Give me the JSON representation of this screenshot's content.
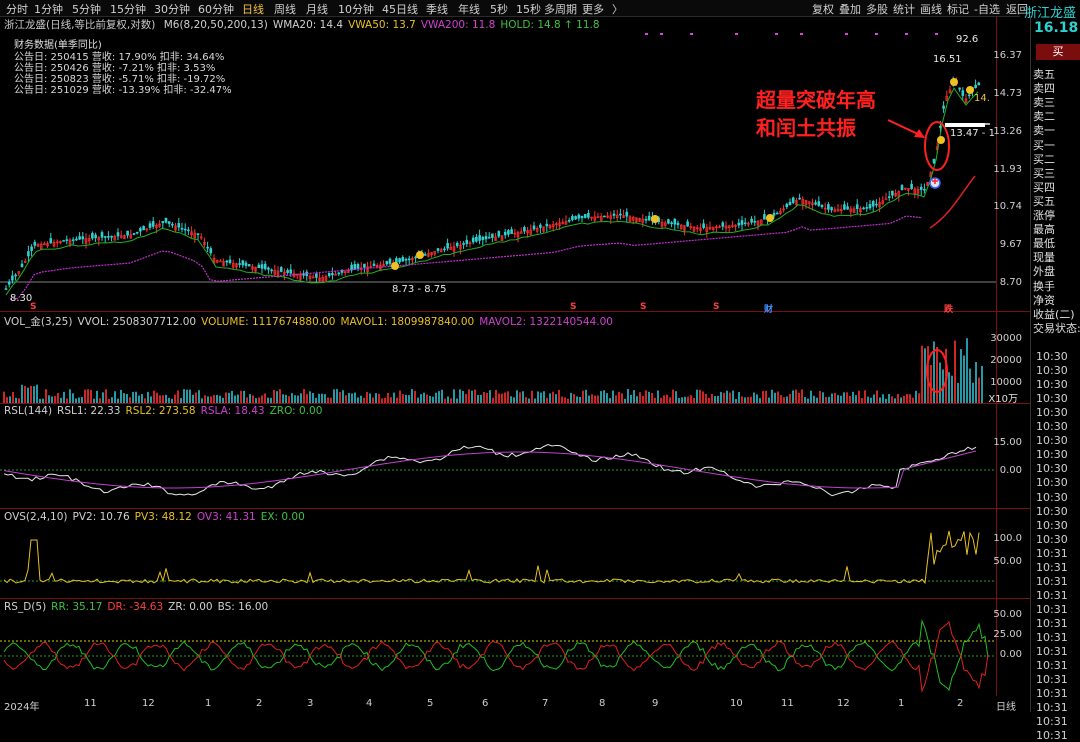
{
  "toolbar": {
    "periods": [
      "分时",
      "1分钟",
      "5分钟",
      "15分钟",
      "30分钟",
      "60分钟",
      "日线",
      "周线",
      "月线",
      "10分钟",
      "45日线",
      "季线",
      "年线",
      "5秒",
      "15秒",
      "多周期",
      "更多"
    ],
    "active_period": "日线",
    "right_tools": [
      "复权",
      "叠加",
      "多股",
      "统计",
      "画线",
      "标记",
      "-自选",
      "返回"
    ]
  },
  "stock": {
    "name": "浙江龙盛",
    "price": "16.18",
    "buy_label": "买"
  },
  "main_chart": {
    "legend_title": "浙江龙盛(日线,等比前复权,对数)",
    "legend_items": [
      {
        "text": "M6(8,20,50,200,13)",
        "color": "#d0d0d0"
      },
      {
        "text": "WMA20: 14.4",
        "color": "#d0d0d0"
      },
      {
        "text": "VWA50: 13.7",
        "color": "#e8c020"
      },
      {
        "text": "VWA200: 11.8",
        "color": "#d040d0"
      },
      {
        "text": "HOLD: 14.8 ↑ 11.8",
        "color": "#40c040"
      }
    ],
    "financials_title": "财务数据(单季同比)",
    "financials": [
      "公告日: 250415  营收: 17.90%  扣非: 34.64%",
      "公告日: 250426  营收: -7.21%  扣非: 3.53%",
      "公告日: 250823  营收: -5.71%  扣非: -19.72%",
      "公告日: 251029  营收: -13.39%  扣非: -32.47%"
    ],
    "y_axis": [
      "16.37",
      "14.73",
      "13.26",
      "11.93",
      "10.74",
      "9.67",
      "8.70"
    ],
    "annotations": {
      "low_start": "8.30",
      "low_range": "8.73 - 8.75",
      "high": "16.51",
      "high_range": "13.47 - 1",
      "top_edge": "92.6",
      "right_val": "14."
    },
    "note_line1": "超量突破年高",
    "note_line2": "和闰土共振",
    "markers": [
      {
        "text": "S",
        "color": "#ff4040"
      },
      {
        "text": "S",
        "color": "#ff4040"
      },
      {
        "text": "S",
        "color": "#ff4040"
      },
      {
        "text": "S",
        "color": "#ff4040"
      },
      {
        "text": "财",
        "color": "#4090ff"
      },
      {
        "text": "跌",
        "color": "#ff4040"
      }
    ]
  },
  "volume_panel": {
    "legend": [
      {
        "text": "VOL_金(3,25)",
        "color": "#d0d0d0"
      },
      {
        "text": "VVOL: 2508307712.00",
        "color": "#d0d0d0"
      },
      {
        "text": "VOLUME: 1117674880.00",
        "color": "#e8c020"
      },
      {
        "text": "MAVOL1: 1809987840.00",
        "color": "#e8c020"
      },
      {
        "text": "MAVOL2: 1322140544.00",
        "color": "#d040d0"
      }
    ],
    "y_axis": [
      "30000",
      "20000",
      "10000"
    ],
    "unit": "X10万"
  },
  "rsl_panel": {
    "legend": [
      {
        "text": "RSL(144)",
        "color": "#d0d0d0"
      },
      {
        "text": "RSL1: 22.33",
        "color": "#d0d0d0"
      },
      {
        "text": "RSL2: 273.58",
        "color": "#e8c020"
      },
      {
        "text": "RSLA: 18.43",
        "color": "#d040d0"
      },
      {
        "text": "ZRO: 0.00",
        "color": "#40c040"
      }
    ],
    "y_axis": [
      "15.00",
      "0.00"
    ]
  },
  "ovs_panel": {
    "legend": [
      {
        "text": "OVS(2,4,10)",
        "color": "#d0d0d0"
      },
      {
        "text": "PV2: 10.76",
        "color": "#d0d0d0"
      },
      {
        "text": "PV3: 48.12",
        "color": "#e8c020"
      },
      {
        "text": "OV3: 41.31",
        "color": "#d040d0"
      },
      {
        "text": "EX: 0.00",
        "color": "#40c040"
      }
    ],
    "y_axis": [
      "100.0",
      "50.00"
    ]
  },
  "rsd_panel": {
    "legend": [
      {
        "text": "RS_D(5)",
        "color": "#d0d0d0"
      },
      {
        "text": "RR: 35.17",
        "color": "#40c040"
      },
      {
        "text": "DR: -34.63",
        "color": "#ff4040"
      },
      {
        "text": "ZR: 0.00",
        "color": "#d0d0d0"
      },
      {
        "text": "BS: 16.00",
        "color": "#d0d0d0"
      }
    ],
    "y_axis": [
      "50.00",
      "25.00",
      "0.00"
    ]
  },
  "x_axis": {
    "months": [
      "2024年",
      "11",
      "12",
      "1",
      "2",
      "3",
      "4",
      "5",
      "6",
      "7",
      "8",
      "9",
      "10",
      "11",
      "12",
      "1",
      "2"
    ],
    "period_label": "日线"
  },
  "order_book": {
    "labels": [
      "卖五",
      "卖四",
      "卖三",
      "卖二",
      "卖一",
      "买一",
      "买二",
      "买三",
      "买四",
      "买五",
      "涨停",
      "最高",
      "最低",
      "现量",
      "外盘",
      "换手",
      "净资",
      "收益(二)",
      "交易状态:"
    ],
    "times": [
      "10:30",
      "10:30",
      "10:30",
      "10:30",
      "10:30",
      "10:30",
      "10:30",
      "10:30",
      "10:30",
      "10:30",
      "10:30",
      "10:30",
      "10:30",
      "10:30",
      "10:31",
      "10:31",
      "10:31",
      "10:31",
      "10:31",
      "10:31",
      "10:31",
      "10:31",
      "10:31",
      "10:31",
      "10:31",
      "10:31",
      "10:31",
      "10:31"
    ]
  },
  "colors": {
    "up": "#ff3030",
    "down": "#30d0d0",
    "ma_green": "#20b020",
    "ma_purple": "#c030d0",
    "ma_red": "#e02020",
    "accent": "#f0c040"
  }
}
